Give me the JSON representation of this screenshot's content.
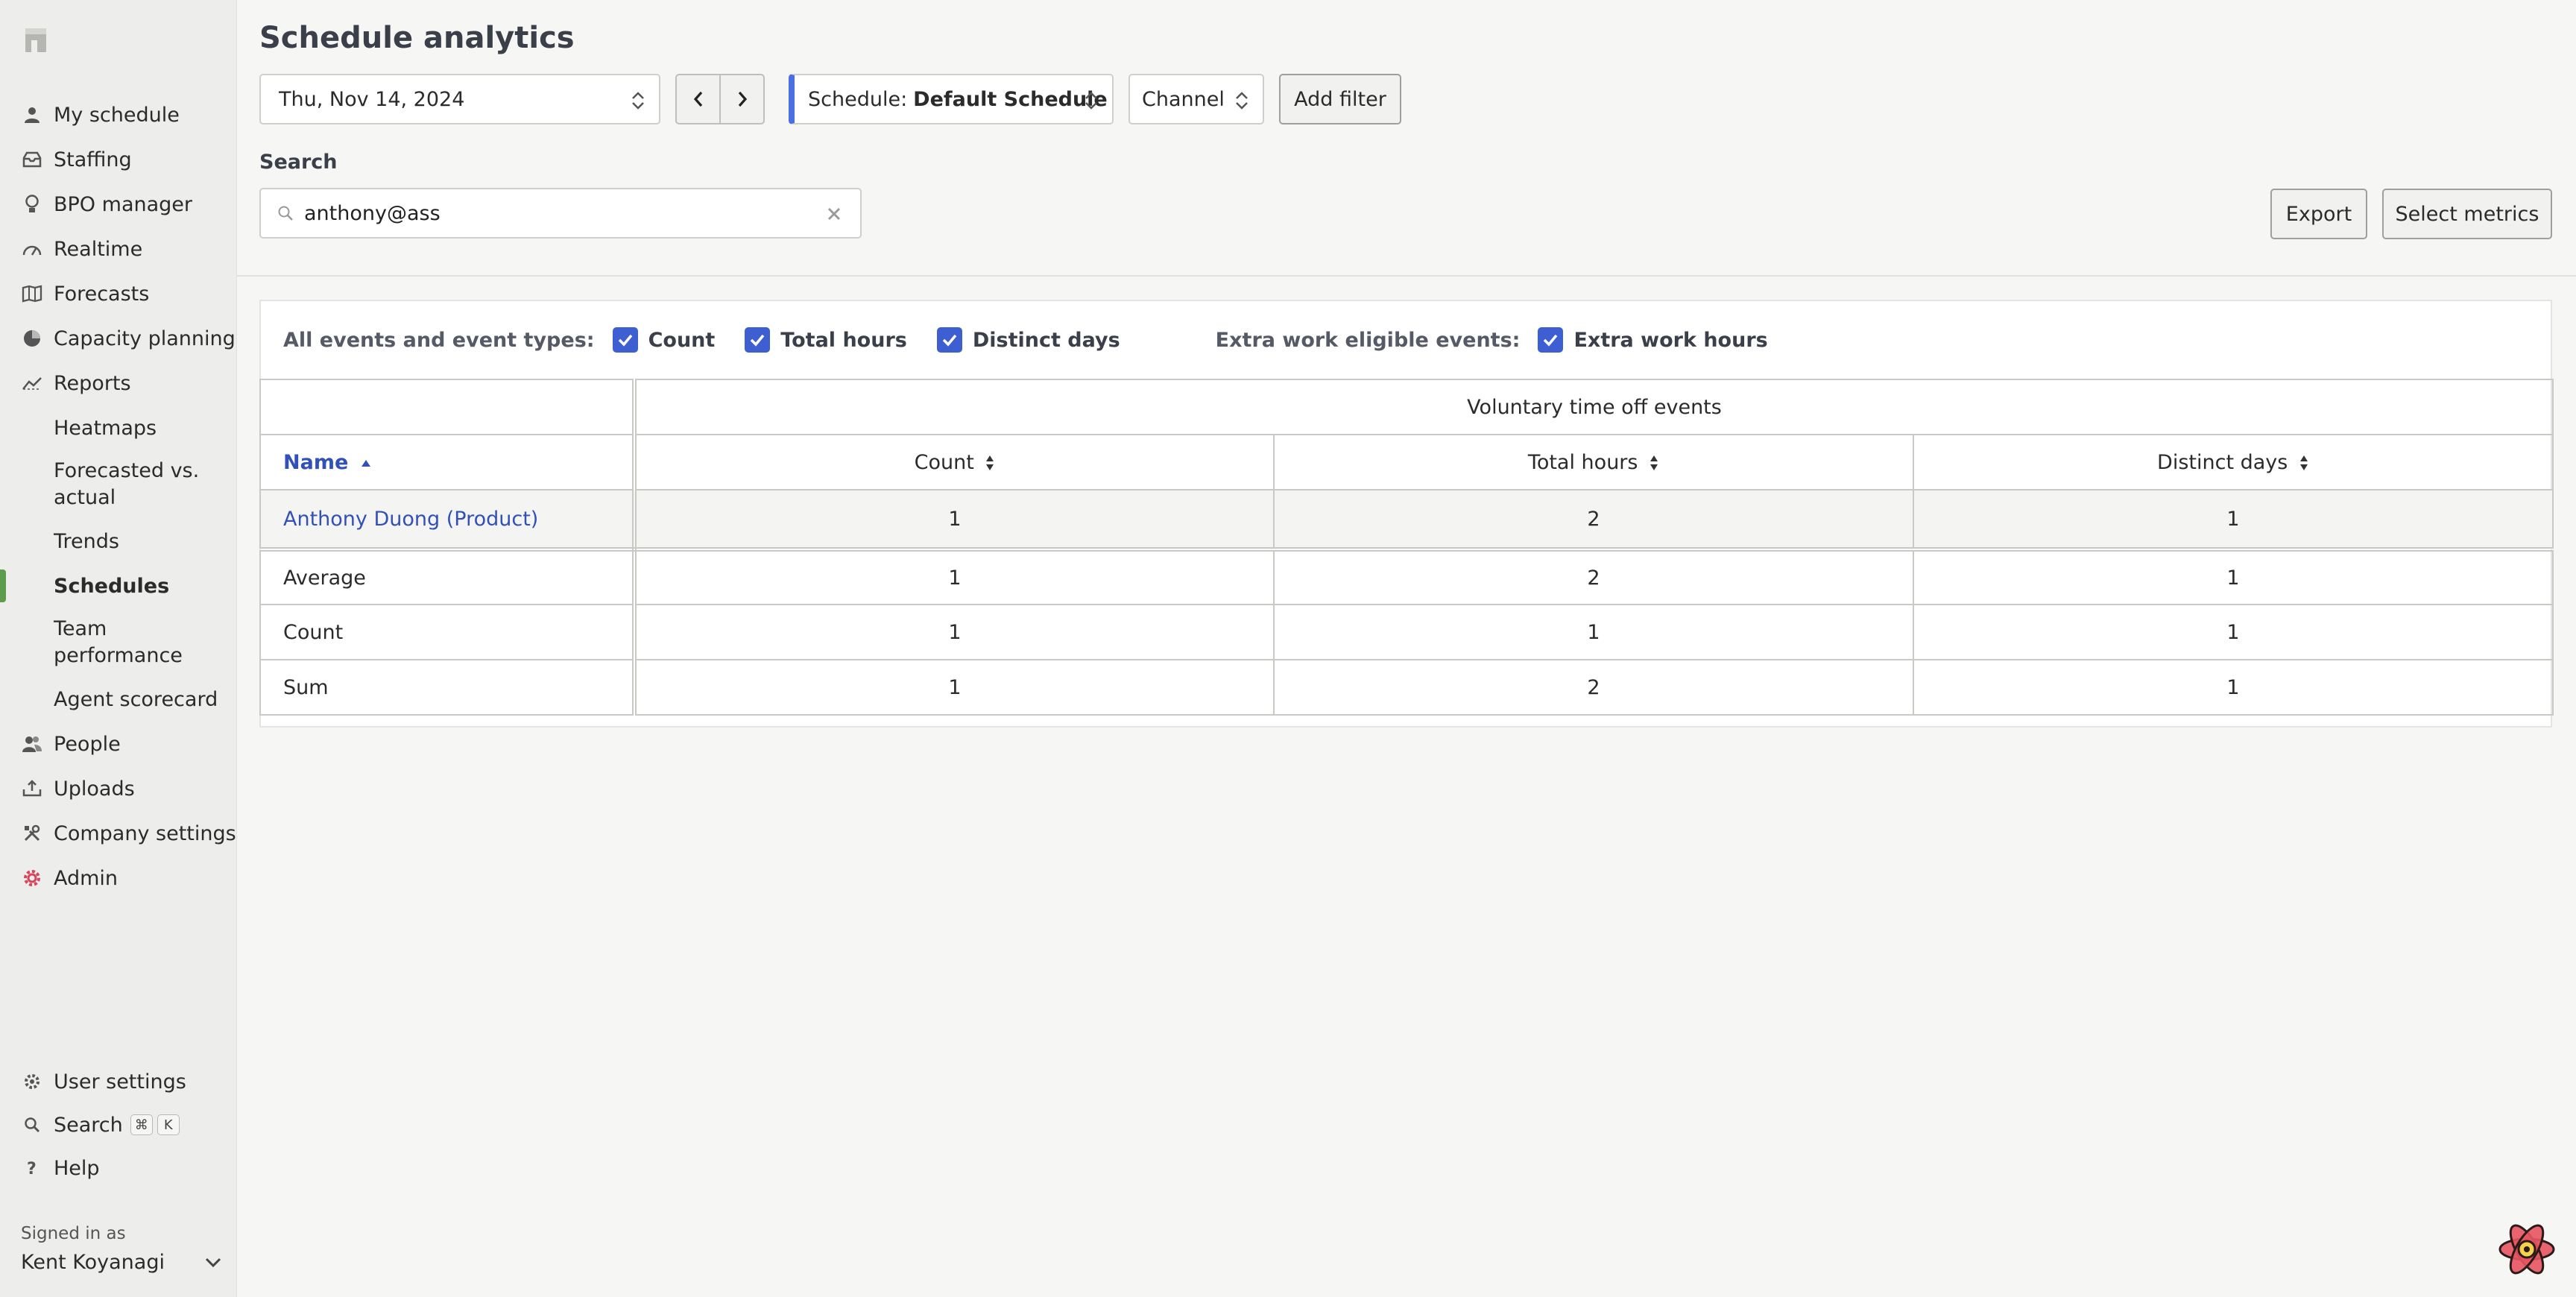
{
  "sidebar": {
    "nav": [
      {
        "label": "My schedule",
        "icon": "user-icon"
      },
      {
        "label": "Staffing",
        "icon": "inbox-icon"
      },
      {
        "label": "BPO manager",
        "icon": "lightbulb-icon"
      },
      {
        "label": "Realtime",
        "icon": "gauge-icon"
      },
      {
        "label": "Forecasts",
        "icon": "map-icon"
      },
      {
        "label": "Capacity planning",
        "icon": "pie-chart-icon"
      },
      {
        "label": "Reports",
        "icon": "trend-icon"
      }
    ],
    "report_sub": [
      "Heatmaps",
      "Forecasted vs. actual",
      "Trends",
      "Schedules",
      "Team performance",
      "Agent scorecard"
    ],
    "nav_after": [
      {
        "label": "People",
        "icon": "people-icon"
      },
      {
        "label": "Uploads",
        "icon": "upload-icon"
      },
      {
        "label": "Company settings",
        "icon": "tools-icon"
      },
      {
        "label": "Admin",
        "icon": "gear-red-icon"
      }
    ],
    "bottom": {
      "user_settings": "User settings",
      "search": "Search",
      "search_keys": [
        "⌘",
        "K"
      ],
      "help": "Help"
    },
    "signed_in_label": "Signed in as",
    "signed_in_user": "Kent Koyanagi"
  },
  "header": {
    "title": "Schedule analytics",
    "date": "Thu, Nov 14, 2024",
    "schedule_prefix": "Schedule:",
    "schedule_value": "Default Schedule",
    "channel": "Channel",
    "add_filter": "Add filter",
    "search_label": "Search",
    "search_value": "anthony@ass",
    "export": "Export",
    "select_metrics": "Select metrics"
  },
  "metrics": {
    "all_label": "All events and event types:",
    "all_checks": [
      "Count",
      "Total hours",
      "Distinct days"
    ],
    "extra_label": "Extra work eligible events:",
    "extra_checks": [
      "Extra work hours"
    ]
  },
  "table": {
    "group_header": "Voluntary time off events",
    "name_header": "Name",
    "columns": [
      "Count",
      "Total hours",
      "Distinct days"
    ],
    "rows": [
      {
        "name": "Anthony Duong (Product)",
        "values": [
          "1",
          "2",
          "1"
        ]
      }
    ],
    "summary": [
      {
        "name": "Average",
        "values": [
          "1",
          "2",
          "1"
        ]
      },
      {
        "name": "Count",
        "values": [
          "1",
          "1",
          "1"
        ]
      },
      {
        "name": "Sum",
        "values": [
          "1",
          "2",
          "1"
        ]
      }
    ]
  },
  "colors": {
    "accent": "#3e5fd1",
    "active": "#5f9b4c",
    "link": "#3150b8"
  }
}
